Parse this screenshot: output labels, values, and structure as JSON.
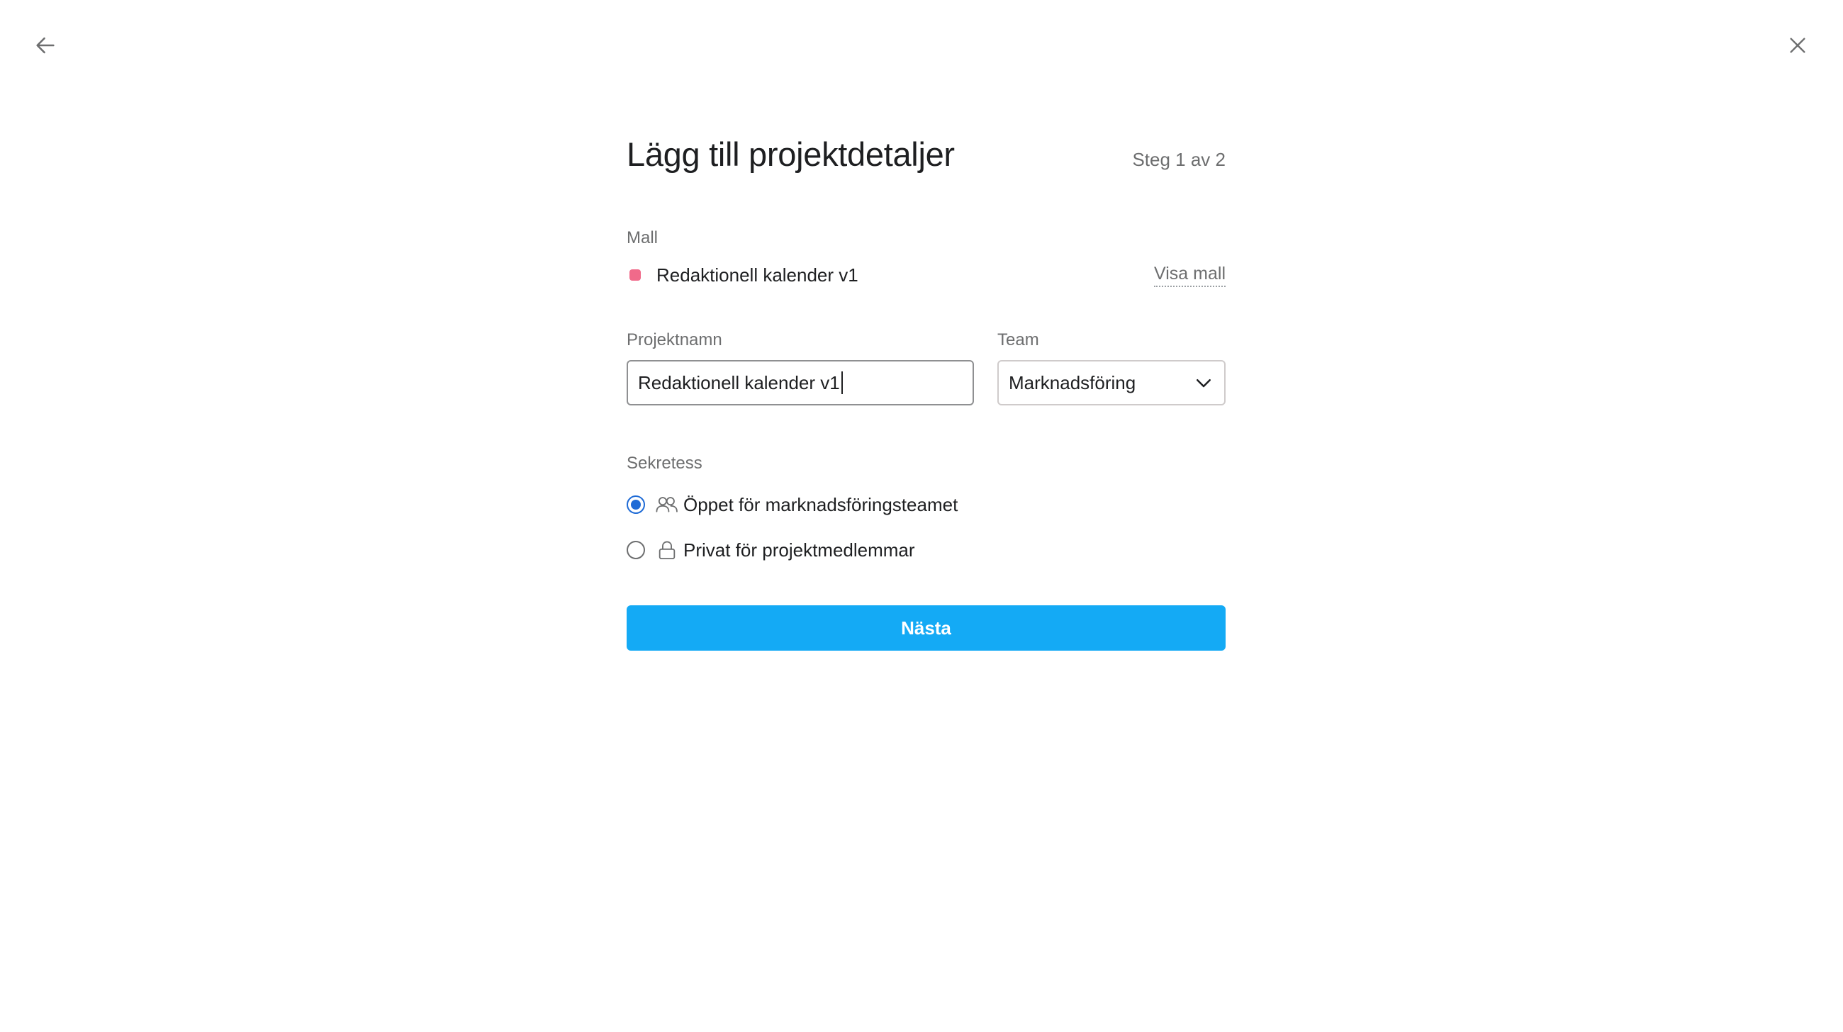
{
  "header": {
    "title": "Lägg till projektdetaljer",
    "step": "Steg 1 av 2"
  },
  "nav": {
    "back_icon": "arrow-left-icon",
    "close_icon": "close-icon"
  },
  "template": {
    "label": "Mall",
    "name": "Redaktionell kalender v1",
    "view_link": "Visa mall",
    "dot_color": "#f06a8a"
  },
  "project_name": {
    "label": "Projektnamn",
    "value": "Redaktionell kalender v1"
  },
  "team": {
    "label": "Team",
    "selected": "Marknadsföring"
  },
  "privacy": {
    "label": "Sekretess",
    "options": [
      {
        "label": "Öppet för marknadsföringsteamet",
        "icon": "team-icon",
        "selected": true
      },
      {
        "label": "Privat för projektmedlemmar",
        "icon": "lock-icon",
        "selected": false
      }
    ]
  },
  "actions": {
    "next_label": "Nästa"
  },
  "colors": {
    "primary": "#14aaf5",
    "radio_selected": "#1f6bd6",
    "text": "#1e1f21",
    "muted": "#6d6e6f"
  }
}
